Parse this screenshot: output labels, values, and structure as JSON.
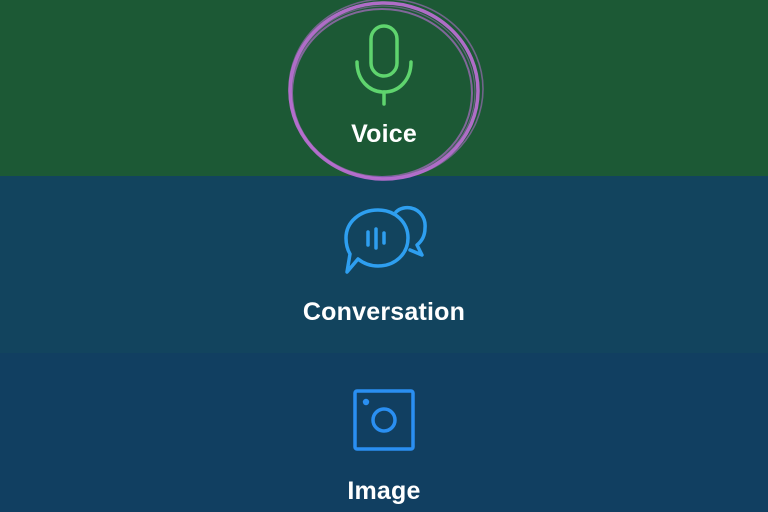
{
  "colors": {
    "voice_bg": "#1c5935",
    "conversation_bg": "#12445e",
    "image_bg": "#113f61",
    "voice_icon": "#5fd46e",
    "conversation_icon": "#2e9ff0",
    "image_icon": "#2a8ff2",
    "selection_ring": "#b76fd0",
    "label_text": "#ffffff"
  },
  "modes": {
    "voice": {
      "label": "Voice",
      "icon": "microphone-icon",
      "selected": true
    },
    "conversation": {
      "label": "Conversation",
      "icon": "chat-bubbles-icon",
      "selected": false
    },
    "image": {
      "label": "Image",
      "icon": "camera-icon",
      "selected": false
    }
  }
}
